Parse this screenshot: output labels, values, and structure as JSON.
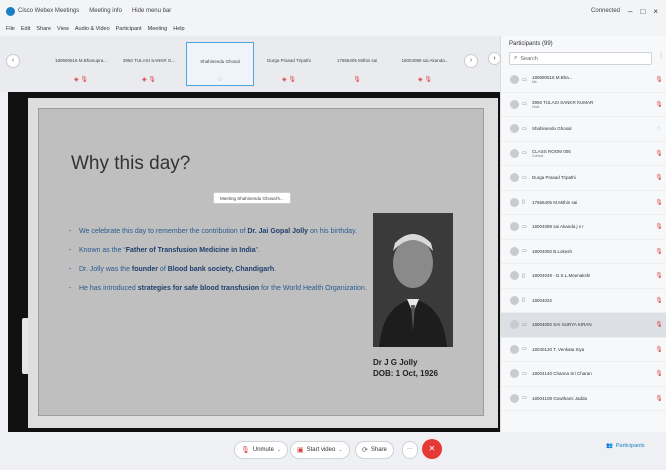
{
  "titlebar": {
    "app_title": "Cisco Webex Meetings",
    "meeting_info": "Meeting info",
    "hide_menu": "Hide menu bar",
    "connected": "Connected",
    "minimize": "–",
    "maximize": "□",
    "close": "×"
  },
  "menubar": {
    "items": [
      "File",
      "Edit",
      "Share",
      "View",
      "Audio & Video",
      "Participant",
      "Meeting",
      "Help"
    ]
  },
  "strip": {
    "thumbnails": [
      {
        "name": "180690516 M.Bhanupra...",
        "mic": "◈ 🎙"
      },
      {
        "name": "3950 TULASI SANKR G...",
        "mic": "◈ 🎙"
      },
      {
        "name": "Shahinendu Ghosal",
        "mic": "◌"
      },
      {
        "name": "Durga Prasad Tripathi",
        "mic": "◈ 🎙"
      },
      {
        "name": "17656405 Mithin sai",
        "mic": "🎙"
      },
      {
        "name": "18004089 sai Akanda...",
        "mic": "◈ 🎙"
      }
    ],
    "prev": "‹",
    "next": "›"
  },
  "stage": {
    "tooltip": "Meeting Shahinendu Ghosal's...",
    "slide": {
      "title": "Why this day?",
      "bullets": [
        {
          "pre": "We celebrate this day to remember the contribution of ",
          "bold": "Dr. Jai Gopal Jolly",
          "post": " on his birthday."
        },
        {
          "pre": "Known as the “",
          "bold": "Father of Transfusion Medicine in India",
          "post": "”."
        },
        {
          "pre": "Dr. Jolly was the ",
          "bold": "founder",
          "mid": " of ",
          "bold2": "Blood bank society, Chandigarh",
          "post": "."
        },
        {
          "pre": "He has introduced ",
          "bold": "strategies for safe blood transfusion",
          "post": " for the World Health Organization."
        }
      ],
      "caption_name": "Dr J G Jolly",
      "caption_dob": "DOB: 1 Oct, 1926"
    }
  },
  "panel": {
    "title": "Participants (99)",
    "search_placeholder": "Search",
    "participants": [
      {
        "name": "180690516 M.Bha...",
        "sub": "Me",
        "mic": "🎙"
      },
      {
        "name": "3950 TULASI SANKR KUMAR",
        "sub": "Host",
        "mic": "🎙"
      },
      {
        "name": "Shahinendu Ghosal",
        "sub": "",
        "mic": "◌"
      },
      {
        "name": "CLASS ROOM 005",
        "sub": "Cohost",
        "mic": "🎙"
      },
      {
        "name": "Durga Prasad Tripathi",
        "sub": "",
        "mic": "🎙"
      },
      {
        "name": "17656405 M.Mithin sai",
        "sub": "",
        "mic": "🎙"
      },
      {
        "name": "18004089 sai Akanda j s r",
        "sub": "",
        "mic": "🎙"
      },
      {
        "name": "18004050 B.Lokesh",
        "sub": "",
        "mic": "🎙"
      },
      {
        "name": "18004049 - D.S.L.Meenakshi",
        "sub": "",
        "mic": "🎙"
      },
      {
        "name": "18004022",
        "sub": "",
        "mic": "🎙"
      },
      {
        "name": "18004092 SAI SURYA KIRAN",
        "sub": "",
        "mic": "🎙"
      },
      {
        "name": "18040120 T. Venkata Siya",
        "sub": "",
        "mic": "🎙"
      },
      {
        "name": "18004140 Channa Sri Charan",
        "sub": "",
        "mic": "🎙"
      },
      {
        "name": "18004108 Gowthami Jadda",
        "sub": "",
        "mic": "🎙"
      }
    ]
  },
  "controls": {
    "unmute": "Unmute",
    "start_video": "Start video",
    "share": "Share",
    "more": "···",
    "end": "✕",
    "participants": "Participants"
  }
}
